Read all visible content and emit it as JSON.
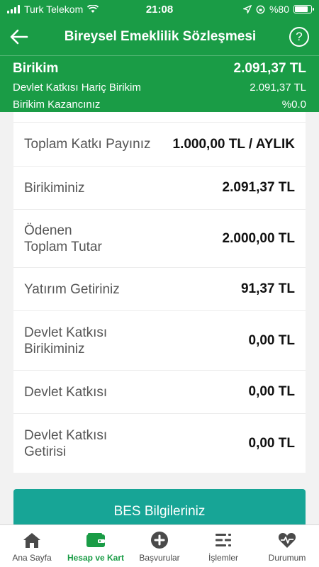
{
  "status_bar": {
    "carrier": "Turk Telekom",
    "time": "21:08",
    "battery": "%80"
  },
  "header": {
    "title": "Bireysel Emeklilik Sözleşmesi"
  },
  "summary": {
    "main_label": "Birikim",
    "main_value": "2.091,37 TL",
    "rows": [
      {
        "label": "Devlet Katkısı Hariç Birikim",
        "value": "2.091,37 TL"
      },
      {
        "label": "Birikim Kazancınız",
        "value": "%0.0"
      }
    ]
  },
  "details": [
    {
      "label": "Toplam Katkı Payınız",
      "value": "1.000,00 TL / AYLIK"
    },
    {
      "label": "Birikiminiz",
      "value": "2.091,37 TL"
    },
    {
      "label": "Ödenen\nToplam Tutar",
      "value": "2.000,00 TL"
    },
    {
      "label": "Yatırım Getiriniz",
      "value": "91,37 TL"
    },
    {
      "label": "Devlet Katkısı\nBirikiminiz",
      "value": "0,00 TL"
    },
    {
      "label": "Devlet Katkısı",
      "value": "0,00 TL"
    },
    {
      "label": "Devlet Katkısı\nGetirisi",
      "value": "0,00 TL"
    }
  ],
  "action_button": {
    "label": "BES Bilgileriniz"
  },
  "tabbar": [
    {
      "label": "Ana Sayfa",
      "icon": "home-icon"
    },
    {
      "label": "Hesap ve Kart",
      "icon": "wallet-icon",
      "active": true
    },
    {
      "label": "Başvurular",
      "icon": "plus-circle-icon"
    },
    {
      "label": "İşlemler",
      "icon": "list-icon"
    },
    {
      "label": "Durumum",
      "icon": "heart-pulse-icon"
    }
  ],
  "colors": {
    "primary_green": "#1a9c46",
    "button_teal": "#17a596"
  }
}
